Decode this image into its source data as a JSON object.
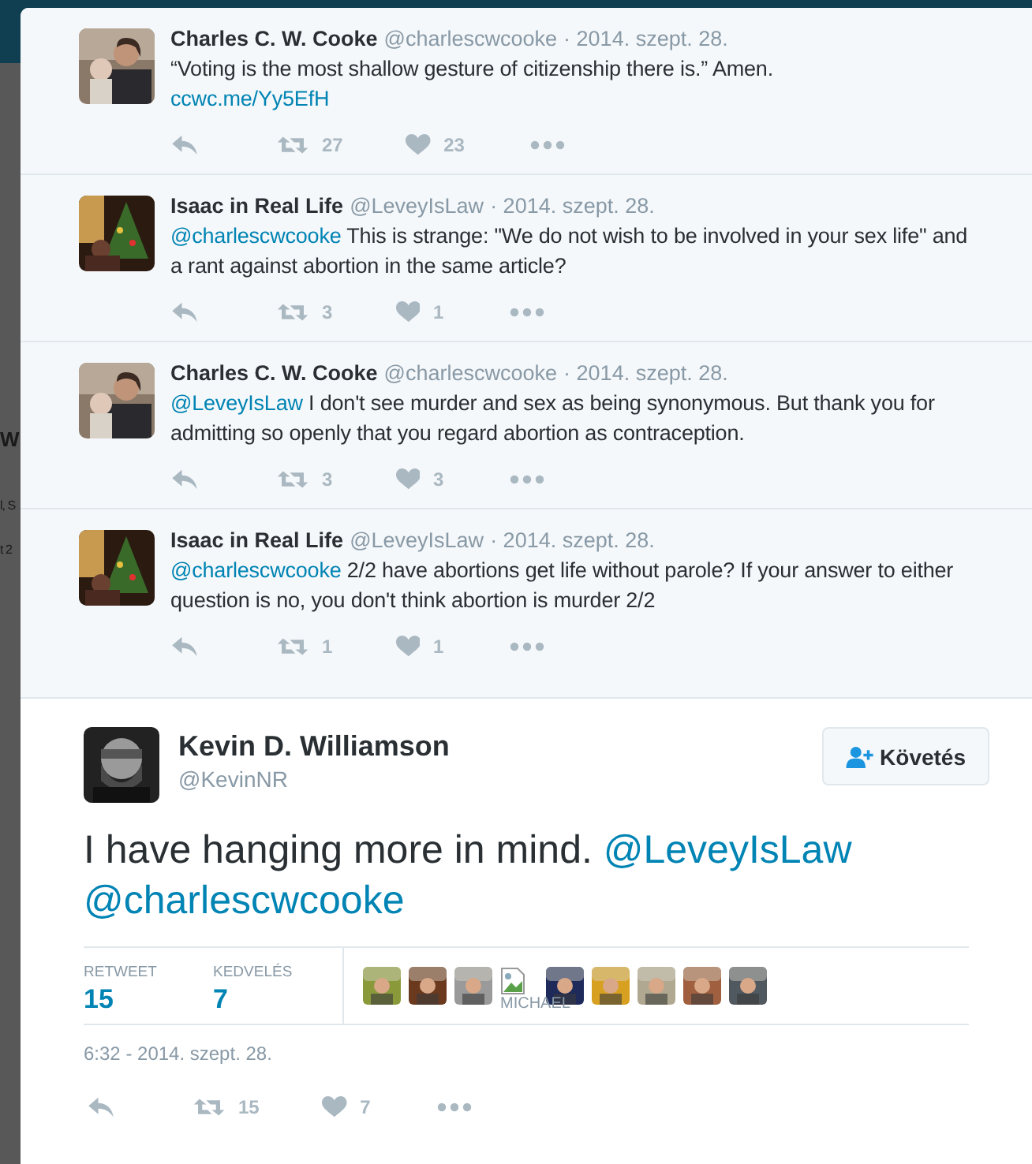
{
  "background": {
    "fragments": [
      "W",
      "l, S",
      "t 2"
    ]
  },
  "replies": [
    {
      "name": "Charles C. W. Cooke",
      "handle": "@charlescwcooke",
      "date": "· 2014. szept. 28.",
      "text": [
        {
          "kind": "plain",
          "text": "“Voting is the most shallow gesture of citizenship there is.” Amen."
        },
        {
          "kind": "link",
          "text": "ccwc.me/Yy5EfH"
        }
      ],
      "retweets": "27",
      "likes": "23"
    },
    {
      "name": "Isaac in Real Life",
      "handle": "@LeveyIsLaw",
      "date": "· 2014. szept. 28.",
      "text": [
        {
          "kind": "mention",
          "text": "@charlescwcooke"
        },
        {
          "kind": "plain",
          "text": " This is strange: \"We do not wish to be involved in your sex life\" and a rant against abortion in the same article?"
        }
      ],
      "retweets": "3",
      "likes": "1"
    },
    {
      "name": "Charles C. W. Cooke",
      "handle": "@charlescwcooke",
      "date": "· 2014. szept. 28.",
      "text": [
        {
          "kind": "mention",
          "text": "@LeveyIsLaw"
        },
        {
          "kind": "plain",
          "text": " I don't see murder and sex as being synonymous. But thank you for admitting so openly that you regard abortion as contraception."
        }
      ],
      "retweets": "3",
      "likes": "3"
    },
    {
      "name": "Isaac in Real Life",
      "handle": "@LeveyIsLaw",
      "date": "· 2014. szept. 28.",
      "text": [
        {
          "kind": "mention",
          "text": "@charlescwcooke"
        },
        {
          "kind": "plain",
          "text": " 2/2 have abortions get life without parole?  If your answer to either question is no, you don't think abortion is murder 2/2"
        }
      ],
      "retweets": "1",
      "likes": "1"
    }
  ],
  "main": {
    "name": "Kevin D. Williamson",
    "handle": "@KevinNR",
    "follow_button": "Követés",
    "text": [
      {
        "kind": "plain",
        "text": "I have hanging more in mind. "
      },
      {
        "kind": "mention",
        "text": "@LeveyIsLaw"
      },
      {
        "kind": "mention",
        "text": "@charlescwcooke"
      }
    ],
    "stats": [
      {
        "label": "RETWEET",
        "value": "15"
      },
      {
        "label": "KEDVELÉS",
        "value": "7"
      }
    ],
    "likers": [
      {
        "kind": "picture"
      },
      {
        "kind": "picture"
      },
      {
        "kind": "picture"
      },
      {
        "kind": "broken",
        "alt": "MICHAEL"
      },
      {
        "kind": "picture"
      },
      {
        "kind": "picture"
      },
      {
        "kind": "picture"
      },
      {
        "kind": "picture"
      },
      {
        "kind": "picture"
      }
    ],
    "timestamp": "6:32 - 2014. szept. 28.",
    "retweets": "15",
    "likes": "7"
  }
}
